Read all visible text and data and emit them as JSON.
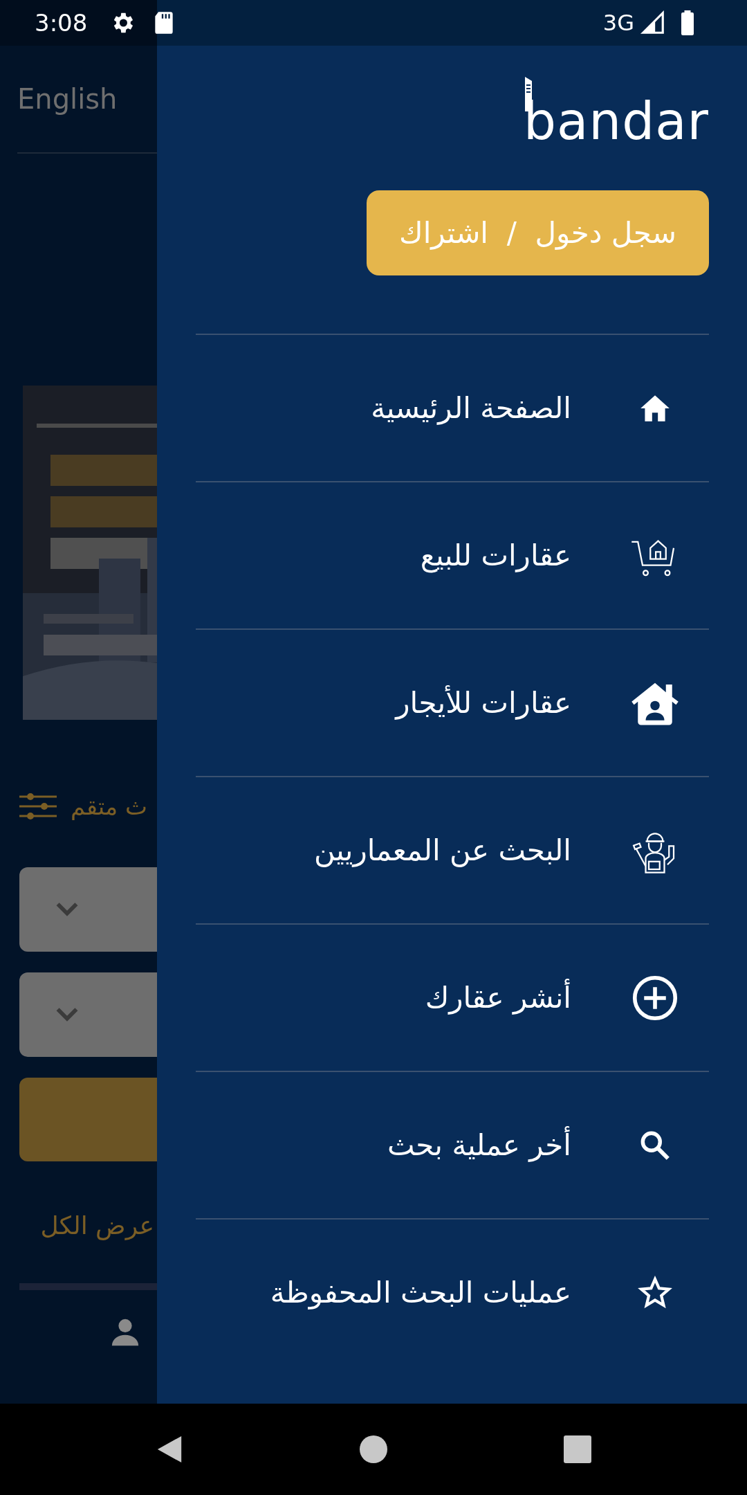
{
  "status_bar": {
    "time": "3:08",
    "network": "3G"
  },
  "background": {
    "language": "English",
    "filter_label": "ث متقم",
    "view_all": "عرض الكل"
  },
  "drawer": {
    "logo": "bandar",
    "login_button": "سجل دخول  /  اشتراك",
    "items": [
      {
        "label": "الصفحة الرئيسية",
        "kind": "home"
      },
      {
        "label": "عقارات للبيع",
        "kind": "sale"
      },
      {
        "label": "عقارات للأيجار",
        "kind": "rent"
      },
      {
        "label": "البحث عن المعماريين",
        "kind": "architects"
      },
      {
        "label": "أنشر عقارك",
        "kind": "post"
      },
      {
        "label": "أخر عملية بحث",
        "kind": "recent"
      },
      {
        "label": "عمليات البحث المحفوظة",
        "kind": "saved"
      }
    ]
  }
}
